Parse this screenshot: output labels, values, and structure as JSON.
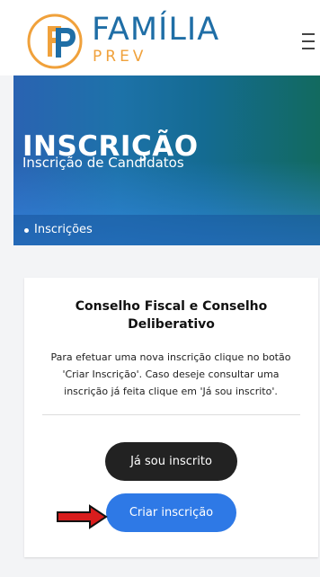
{
  "header": {
    "brand": {
      "name": "FAMÍLIA",
      "suffix": "PREV",
      "mark_text": "FP",
      "colors": {
        "primary": "#1f6ea6",
        "accent": "#f0a13b"
      }
    },
    "menu_icon": "hamburger-menu-icon"
  },
  "hero": {
    "title": "INSCRIÇÃO",
    "subtitle": "Inscrição de Candidatos",
    "breadcrumb": "Inscrições",
    "colors": {
      "start": "#2a63b2",
      "middle": "#146b92",
      "end": "#126a5f"
    }
  },
  "card": {
    "title": "Conselho Fiscal e Conselho Deliberativo",
    "description": "Para efetuar uma nova inscrição clique no botão 'Criar Inscrição'. Caso deseje consultar uma inscrição já feita clique em 'Já sou inscrito'.",
    "already_registered_label": "Já sou inscrito",
    "create_registration_label": "Criar inscrição",
    "indicator_icon": "red-arrow-icon",
    "colors": {
      "already_button": "#222222",
      "create_button": "#2e79e6",
      "indicator": "#d91d1d"
    }
  }
}
